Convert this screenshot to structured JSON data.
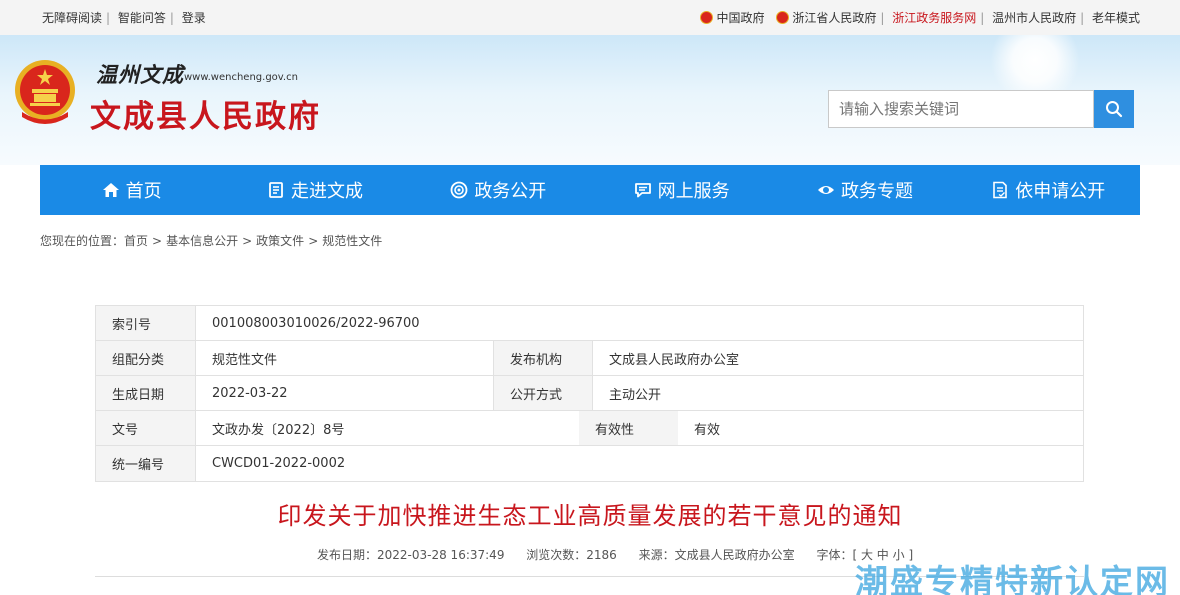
{
  "topbar": {
    "left": [
      "无障碍阅读",
      "智能问答",
      "登录"
    ],
    "right": [
      "中国政府",
      "浙江省人民政府",
      "浙江政务服务网",
      "温州市人民政府",
      "老年模式"
    ]
  },
  "header": {
    "calligraphy": "温州文成",
    "url": "www.wencheng.gov.cn",
    "title": "文成县人民政府"
  },
  "search": {
    "placeholder": "请输入搜索关键词"
  },
  "nav": [
    {
      "label": "首页",
      "icon": "home-icon"
    },
    {
      "label": "走进文成",
      "icon": "book-icon"
    },
    {
      "label": "政务公开",
      "icon": "broadcast-icon"
    },
    {
      "label": "网上服务",
      "icon": "chat-icon"
    },
    {
      "label": "政务专题",
      "icon": "eye-icon"
    },
    {
      "label": "依申请公开",
      "icon": "document-icon"
    }
  ],
  "breadcrumb": {
    "prefix": "您现在的位置：",
    "items": [
      "首页",
      "基本信息公开",
      "政策文件",
      "规范性文件"
    ],
    "sep": ">"
  },
  "meta": {
    "index_label": "索引号",
    "index_value": "001008003010026/2022-96700",
    "category_label": "组配分类",
    "category_value": "规范性文件",
    "org_label": "发布机构",
    "org_value": "文成县人民政府办公室",
    "date_label": "生成日期",
    "date_value": "2022-03-22",
    "mode_label": "公开方式",
    "mode_value": "主动公开",
    "docno_label": "文号",
    "docno_value": "文政办发〔2022〕8号",
    "validity_label": "有效性",
    "validity_value": "有效",
    "unified_label": "统一编号",
    "unified_value": "CWCD01-2022-0002"
  },
  "document": {
    "title": "印发关于加快推进生态工业高质量发展的若干意见的通知",
    "publish": "发布日期：2022-03-28 16:37:49",
    "views": "浏览次数：2186",
    "source": "来源：文成县人民政府办公室",
    "font": "字体：[ 大 中 小 ]"
  },
  "watermark": "潮盛专精特新认定网",
  "colors": {
    "accent": "#1a8ae6",
    "red": "#c8161d"
  }
}
